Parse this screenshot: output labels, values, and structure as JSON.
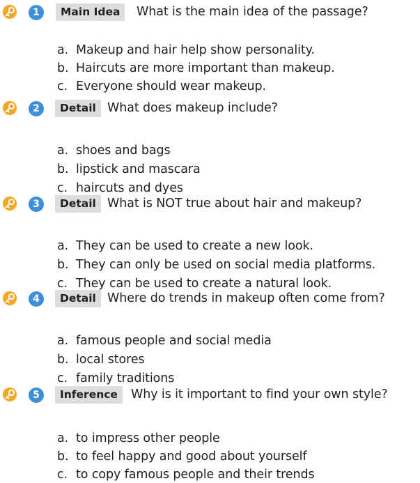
{
  "questions": [
    {
      "number": "1",
      "tag": "Main Idea",
      "question": "What is the main idea of the passage?",
      "options": [
        {
          "letter": "a.",
          "text": "Makeup and hair help show personality."
        },
        {
          "letter": "b.",
          "text": "Haircuts are more important than makeup."
        },
        {
          "letter": "c.",
          "text": "Everyone should wear makeup."
        }
      ]
    },
    {
      "number": "2",
      "tag": "Detail",
      "question": "What does makeup include?",
      "options": [
        {
          "letter": "a.",
          "text": "shoes and bags"
        },
        {
          "letter": "b.",
          "text": "lipstick and mascara"
        },
        {
          "letter": "c.",
          "text": "haircuts and dyes"
        }
      ]
    },
    {
      "number": "3",
      "tag": "Detail",
      "question": "What is NOT true about hair and makeup?",
      "options": [
        {
          "letter": "a.",
          "text": "They can be used to create a new look."
        },
        {
          "letter": "b.",
          "text": "They can only be used on social media platforms."
        },
        {
          "letter": "c.",
          "text": "They can be used to create a natural look."
        }
      ]
    },
    {
      "number": "4",
      "tag": "Detail",
      "question": "Where do trends in makeup often come from?",
      "options": [
        {
          "letter": "a.",
          "text": "famous people and social media"
        },
        {
          "letter": "b.",
          "text": "local stores"
        },
        {
          "letter": "c.",
          "text": "family traditions"
        }
      ]
    },
    {
      "number": "5",
      "tag": "Inference",
      "question": "Why is it important to find your own style?",
      "options": [
        {
          "letter": "a.",
          "text": "to impress other people"
        },
        {
          "letter": "b.",
          "text": "to feel happy and good about yourself"
        },
        {
          "letter": "c.",
          "text": "to copy famous people and their trends"
        }
      ]
    }
  ],
  "colors": {
    "number_badge": "#3d8fd9",
    "tag_background": "#dcdddf",
    "key_icon": "#f4a521",
    "text": "#231f20"
  },
  "icons": {
    "question_marker": "key-icon"
  }
}
